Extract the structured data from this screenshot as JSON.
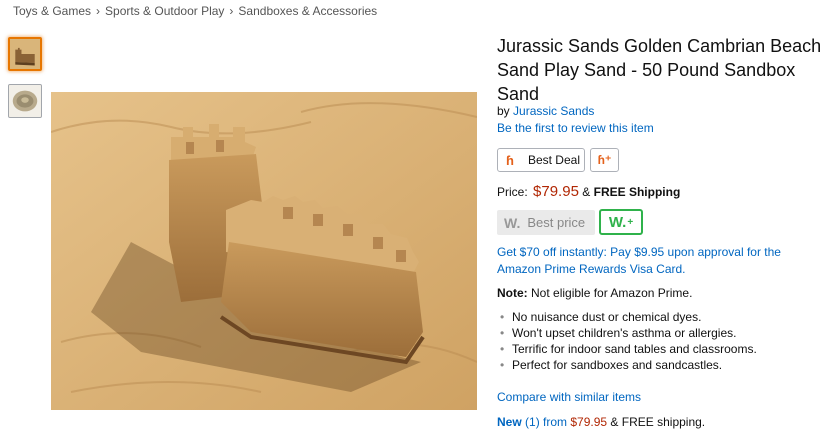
{
  "breadcrumb": {
    "items": [
      "Toys & Games",
      "Sports & Outdoor Play",
      "Sandboxes & Accessories"
    ],
    "separator": "›"
  },
  "thumbnails": [
    {
      "label": "sandcastle-photo",
      "selected": true
    },
    {
      "label": "sand-bag-photo",
      "selected": false
    }
  ],
  "product": {
    "title": "Jurassic Sands Golden Cambrian Beach Sand Play Sand - 50 Pound Sandbox Sand",
    "by_prefix": "by",
    "brand": "Jurassic Sands",
    "review_link": "Be the first to review this item",
    "best_deal_label": "Best Deal",
    "price_label": "Price:",
    "price": "$79.95",
    "shipping_amp": "&",
    "shipping": "FREE Shipping",
    "best_price_label": "Best price",
    "best_price_w": "W.",
    "wplus_label": "W.",
    "wplus_sup": "+",
    "promo": "Get $70 off instantly: Pay $9.95 upon approval for the Amazon Prime Rewards Visa Card.",
    "note_label": "Note:",
    "note_text": "Not eligible for Amazon Prime.",
    "bullets": [
      "No nuisance dust or chemical dyes.",
      "Won't upset children's asthma or allergies.",
      "Terrific for indoor sand tables and classrooms.",
      "Perfect for sandboxes and sandcastles."
    ],
    "compare_link": "Compare with similar items",
    "new_label": "New",
    "new_count": "(1) from",
    "new_price": "$79.95",
    "new_shipping": "& FREE shipping."
  },
  "colors": {
    "link": "#0066c0",
    "price": "#b12704",
    "accent_orange": "#e77600",
    "wplus_green": "#2fb24b"
  }
}
